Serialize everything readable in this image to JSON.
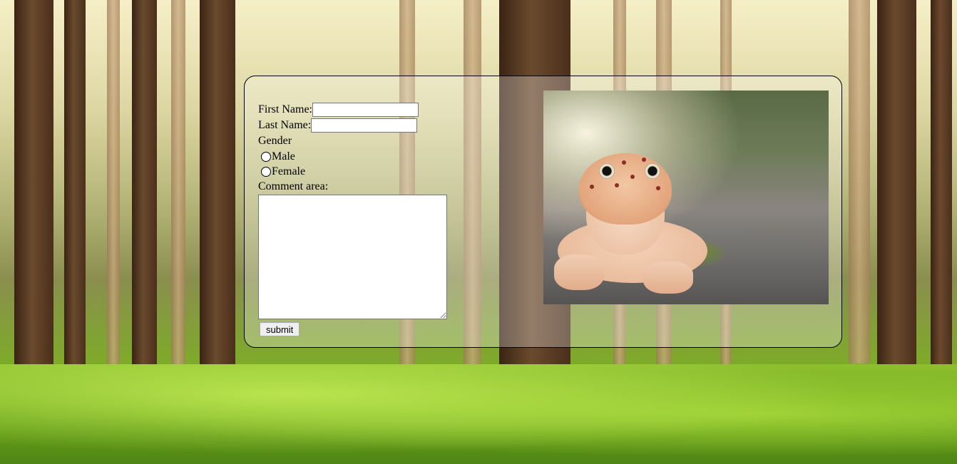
{
  "form": {
    "first_name_label": "First Name:",
    "first_name_value": "",
    "last_name_label": "Last Name:",
    "last_name_value": "",
    "gender_label": "Gender",
    "gender_options": [
      "Male",
      "Female"
    ],
    "comment_label": "Comment area:",
    "comment_value": "",
    "submit_label": "submit"
  },
  "image": {
    "subject": "gecko-photo"
  },
  "background": {
    "subject": "forest-background"
  }
}
